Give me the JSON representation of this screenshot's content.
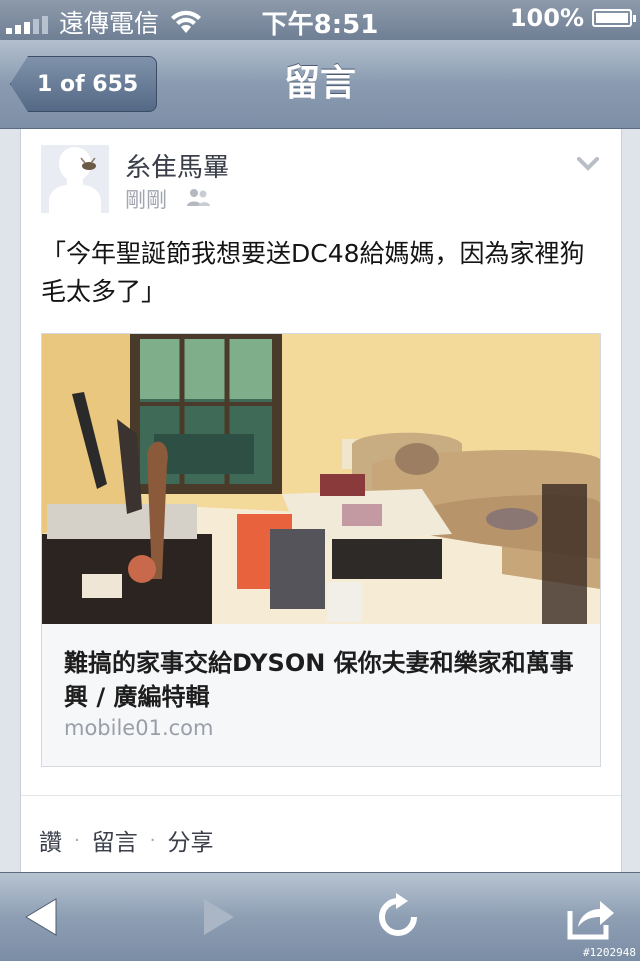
{
  "status_bar": {
    "carrier": "遠傳電信",
    "time": "下午8:51",
    "battery": "100%"
  },
  "nav": {
    "back_label": "1 of 655",
    "title": "留言"
  },
  "post": {
    "author": "糸隹馬罼",
    "time": "剛剛",
    "text": "「今年聖誕節我想要送DC48給媽媽，因為家裡狗毛太多了」",
    "link": {
      "title": "難搞的家事交給DYSON 保你夫妻和樂家和萬事興 / 廣編特輯",
      "domain": "mobile01.com"
    }
  },
  "actions": {
    "like": "讚",
    "comment": "留言",
    "share": "分享",
    "separator": "·"
  },
  "toolbar": {
    "icons": [
      "back-arrow-icon",
      "forward-arrow-icon",
      "reload-icon",
      "share-icon"
    ]
  },
  "watermark": "#1202948",
  "colors": {
    "nav_bar": "#8a9bb1",
    "text_dark": "#151515",
    "text_muted": "#a0a5b0"
  }
}
